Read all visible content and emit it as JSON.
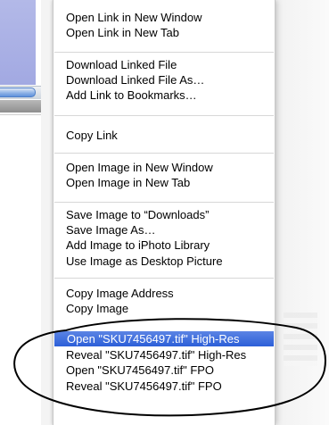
{
  "menu": {
    "items": [
      {
        "label": "Open Link in New Window",
        "highlighted": false
      },
      {
        "label": "Open Link in New Tab",
        "highlighted": false
      },
      {
        "label": "Download Linked File",
        "highlighted": false
      },
      {
        "label": "Download Linked File As…",
        "highlighted": false
      },
      {
        "label": "Add Link to Bookmarks…",
        "highlighted": false
      },
      {
        "label": "Copy Link",
        "highlighted": false
      },
      {
        "label": "Open Image in New Window",
        "highlighted": false
      },
      {
        "label": "Open Image in New Tab",
        "highlighted": false
      },
      {
        "label": "Save Image to “Downloads”",
        "highlighted": false
      },
      {
        "label": "Save Image As…",
        "highlighted": false
      },
      {
        "label": "Add Image to iPhoto Library",
        "highlighted": false
      },
      {
        "label": "Use Image as Desktop Picture",
        "highlighted": false
      },
      {
        "label": "Copy Image Address",
        "highlighted": false
      },
      {
        "label": "Copy Image",
        "highlighted": false
      },
      {
        "label": "Open \"SKU7456497.tif\" High-Res",
        "highlighted": true
      },
      {
        "label": "Reveal \"SKU7456497.tif\" High-Res",
        "highlighted": false
      },
      {
        "label": "Open \"SKU7456497.tif\" FPO",
        "highlighted": false
      },
      {
        "label": "Reveal \"SKU7456497.tif\" FPO",
        "highlighted": false
      }
    ]
  },
  "colors": {
    "highlight_top": "#5b84e4",
    "highlight_bottom": "#2c5fd8",
    "annotation_stroke": "#000000",
    "background_window_blue": "#a9afe4"
  }
}
